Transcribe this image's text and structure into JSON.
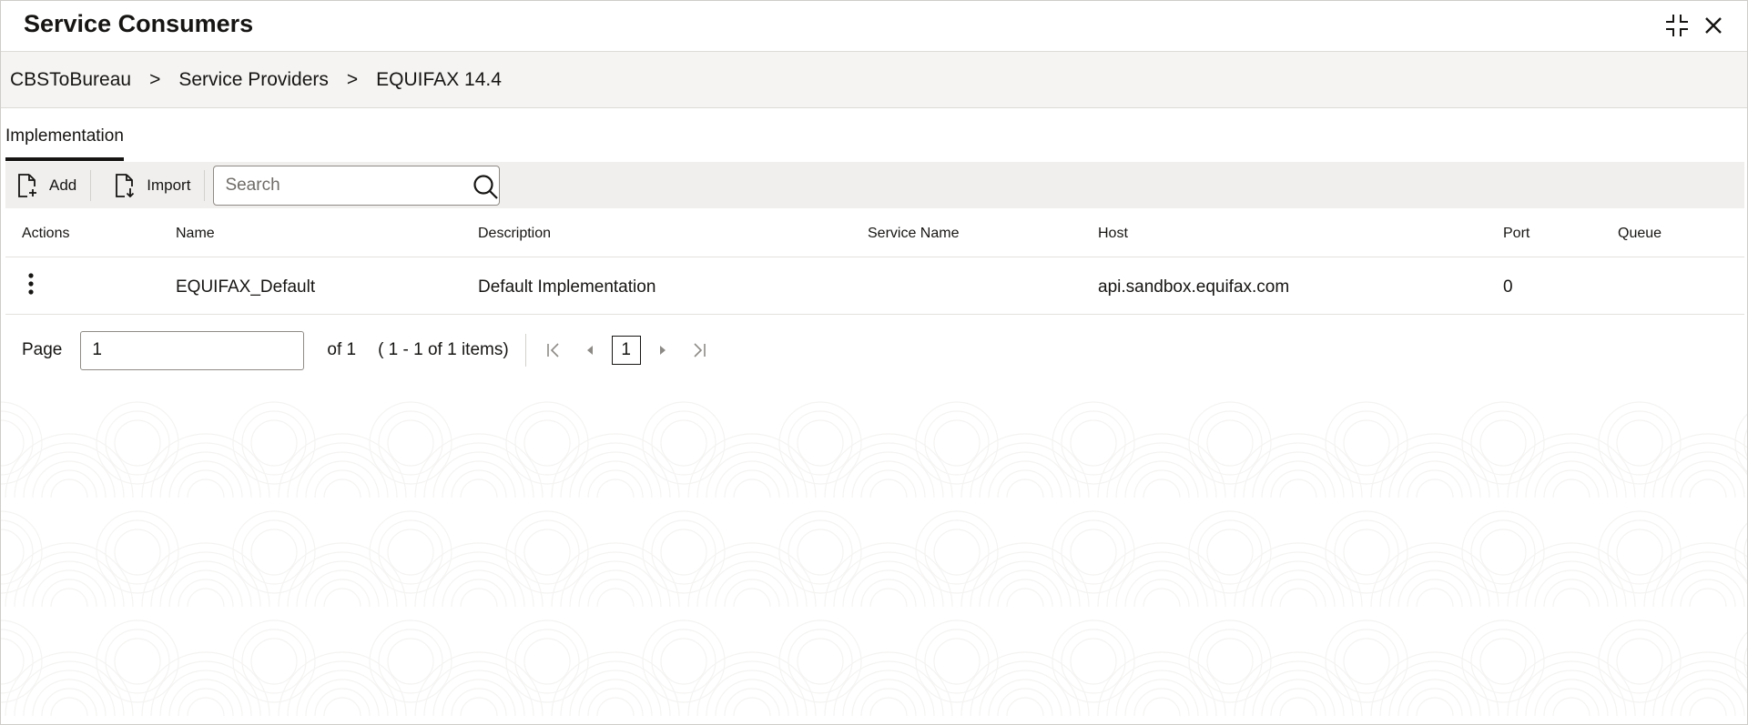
{
  "window": {
    "title": "Service Consumers",
    "icons": {
      "minimize": "compress-icon",
      "close": "close-icon"
    }
  },
  "breadcrumb": {
    "items": [
      "CBSToBureau",
      "Service Providers",
      "EQUIFAX 14.4"
    ],
    "separator": ">"
  },
  "tabs": [
    {
      "label": "Implementation",
      "active": true
    }
  ],
  "toolbar": {
    "add_label": "Add",
    "import_label": "Import",
    "search_placeholder": "Search",
    "search_value": ""
  },
  "table": {
    "columns": [
      "Actions",
      "Name",
      "Description",
      "Service Name",
      "Host",
      "Port",
      "Queue"
    ],
    "rows": [
      {
        "name": "EQUIFAX_Default",
        "description": "Default Implementation",
        "service_name": "",
        "host": "api.sandbox.equifax.com",
        "port": "0",
        "queue": ""
      }
    ]
  },
  "pagination": {
    "page_label": "Page",
    "page_value": "1",
    "of_text": "of 1",
    "range_text": "( 1 - 1 of 1 items)",
    "current_page": "1"
  },
  "colors": {
    "accent": "#161513",
    "toolbar_bg": "#f1efed",
    "breadcrumb_bg": "#f5f4f2",
    "border": "#dedcd8"
  }
}
